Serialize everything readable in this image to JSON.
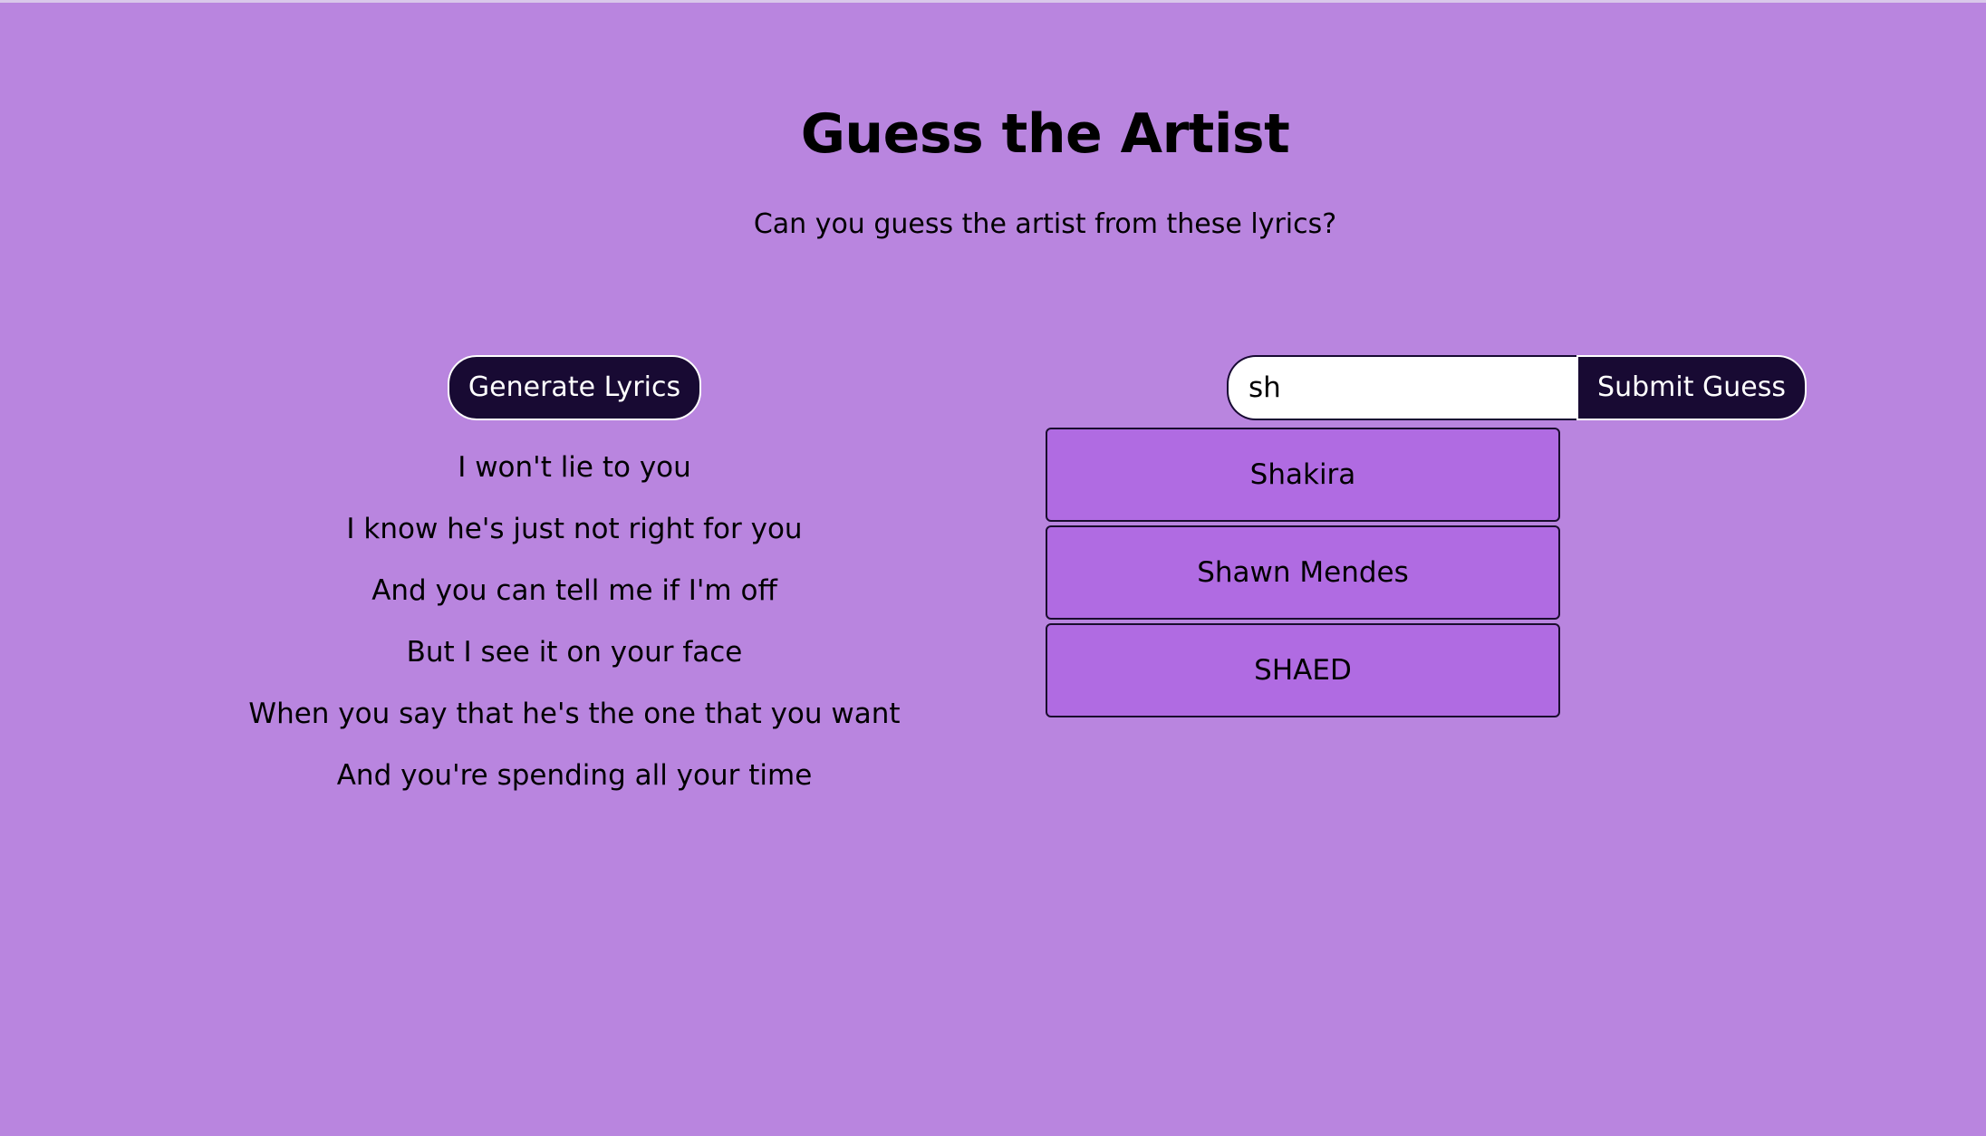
{
  "page": {
    "title": "Guess the Artist",
    "subtitle": "Can you guess the artist from these lyrics?"
  },
  "lyrics_panel": {
    "generate_label": "Generate Lyrics",
    "lines": [
      "I won't lie to you",
      "I know he's just not right for you",
      "And you can tell me if I'm off",
      "But I see it on your face",
      "When you say that he's the one that you want",
      "And you're spending all your time"
    ]
  },
  "guess_panel": {
    "input_value": "sh",
    "submit_label": "Submit Guess",
    "suggestions": [
      "Shakira",
      "Shawn Mendes",
      "SHAED"
    ]
  },
  "colors": {
    "background": "#b985df",
    "button_dark": "#180a33",
    "suggestion_fill": "#b06be2"
  }
}
